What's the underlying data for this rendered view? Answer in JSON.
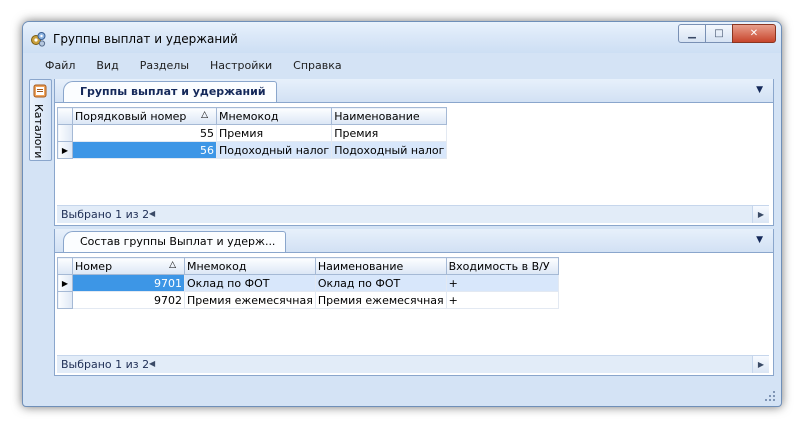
{
  "window": {
    "title": "Группы выплат  и удержаний"
  },
  "window_controls": {
    "minimize": "▁",
    "maximize": "□",
    "close": "✕"
  },
  "menu": [
    "Файл",
    "Вид",
    "Разделы",
    "Настройки",
    "Справка"
  ],
  "side_tab": {
    "label": "Каталоги"
  },
  "top_panel": {
    "tab_title": "Группы выплат  и удержаний",
    "columns": [
      "Порядковый номер",
      "Мнемокод",
      "Наименование"
    ],
    "sort_indicator": "△",
    "rows": [
      {
        "number": "55",
        "mnemo": "Премия",
        "name": "Премия"
      },
      {
        "number": "56",
        "mnemo": "Подоходный налог",
        "name": "Подоходный налог"
      }
    ],
    "selected_row": 1,
    "status": "Выбрано 1 из 2"
  },
  "bottom_panel": {
    "tab_title": "Состав группы Выплат и удерж...",
    "columns": [
      "Номер",
      "Мнемокод",
      "Наименование",
      "Входимость в В/У"
    ],
    "sort_indicator": "△",
    "rows": [
      {
        "number": "9701",
        "mnemo": "Оклад по ФОТ",
        "name": "Оклад по ФОТ",
        "inclusion": "+"
      },
      {
        "number": "9702",
        "mnemo": "Премия ежемесячная",
        "name": "Премия ежемесячная",
        "inclusion": "+"
      }
    ],
    "selected_row": 0,
    "status": "Выбрано 1 из 2"
  },
  "icons": {
    "row_pointer": "▶",
    "panel_collapse": "▼",
    "scroll_left": "◀",
    "scroll_right": "▶"
  },
  "colors": {
    "selection": "#3d96e6",
    "selection_light": "#d8e7fb",
    "frame": "#d4e3f5",
    "tab_title_text": "#15295a"
  }
}
